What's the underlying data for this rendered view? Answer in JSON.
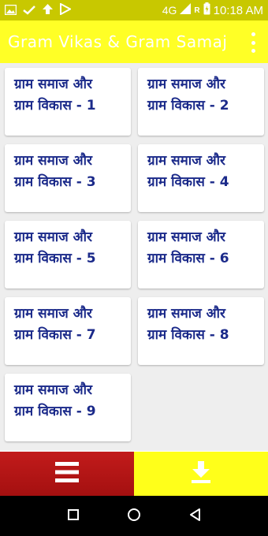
{
  "status_bar": {
    "network_label": "4G",
    "network_small": "4G",
    "roaming": "R",
    "time": "10:18 AM",
    "icons": [
      "image-icon",
      "check-icon",
      "upload-icon",
      "play-store-icon",
      "signal-icon",
      "battery-icon"
    ]
  },
  "app_bar": {
    "title": "Gram Vikas & Gram Samaj",
    "menu_icon": "more-vert-icon"
  },
  "cards": [
    {
      "label": "ग्राम समाज और\nग्राम विकास - 1"
    },
    {
      "label": "ग्राम समाज और\nग्राम विकास - 2"
    },
    {
      "label": "ग्राम समाज और\nग्राम विकास - 3"
    },
    {
      "label": "ग्राम समाज और\nग्राम विकास - 4"
    },
    {
      "label": "ग्राम समाज और\nग्राम विकास - 5"
    },
    {
      "label": "ग्राम समाज और\nग्राम विकास - 6"
    },
    {
      "label": "ग्राम समाज और\nग्राम विकास - 7"
    },
    {
      "label": "ग्राम समाज और\nग्राम विकास - 8"
    },
    {
      "label": "ग्राम समाज और\nग्राम विकास - 9"
    }
  ],
  "bottom_bar": {
    "menu_icon": "hamburger-menu-icon",
    "download_icon": "download-icon"
  },
  "colors": {
    "status_bar": "#c8c800",
    "app_bar": "#ffff26",
    "card_text": "#1b2a8a",
    "menu_button": "#b51515",
    "download_button": "#ffff1a"
  }
}
